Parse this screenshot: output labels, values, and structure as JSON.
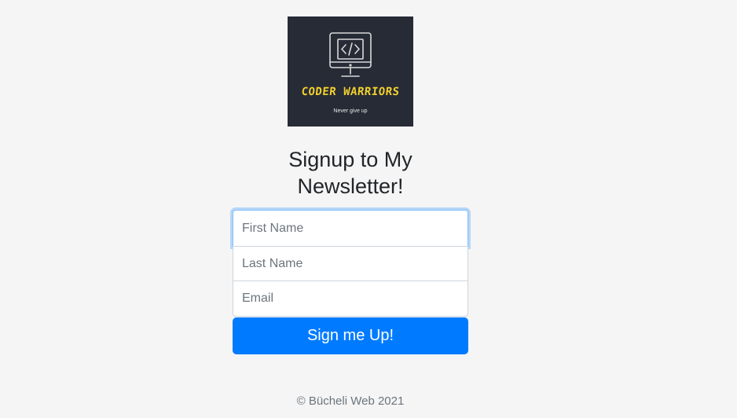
{
  "logo": {
    "name": "CODER WARRIORS",
    "tagline": "Never give up",
    "icon": "monitor-code-icon",
    "background_color": "#262b36",
    "name_color": "#f1cf2f"
  },
  "heading": {
    "line1": "Signup to My",
    "line2": "Newsletter!"
  },
  "form": {
    "first_name_placeholder": "First Name",
    "last_name_placeholder": "Last Name",
    "email_placeholder": "Email",
    "first_name_value": "",
    "last_name_value": "",
    "email_value": "",
    "submit_label": "Sign me Up!",
    "accent_color": "#007bff"
  },
  "footer": {
    "copyright": "© Bücheli Web 2021"
  }
}
